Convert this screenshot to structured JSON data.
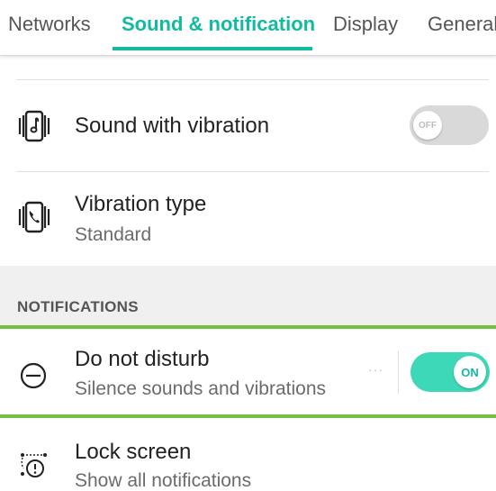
{
  "tabs": [
    {
      "label": "Networks",
      "active": false
    },
    {
      "label": "Sound & notification",
      "active": true
    },
    {
      "label": "Display",
      "active": false
    },
    {
      "label": "General",
      "active": false
    }
  ],
  "accent_color": "#14b9a2",
  "highlight_color": "#72bf44",
  "rows": {
    "sound_with_vibration": {
      "title": "Sound with vibration",
      "icon": "vibrate-music-icon",
      "toggle": "OFF"
    },
    "vibration_type": {
      "title": "Vibration type",
      "subtitle": "Standard",
      "icon": "vibrate-phone-icon"
    },
    "do_not_disturb": {
      "title": "Do not disturb",
      "subtitle": "Silence sounds and vibrations",
      "icon": "minus-circle-icon",
      "toggle": "ON"
    },
    "lock_screen": {
      "title": "Lock screen",
      "subtitle": "Show all notifications",
      "icon": "lock-screen-notification-icon"
    }
  },
  "section": {
    "notifications": "NOTIFICATIONS"
  }
}
